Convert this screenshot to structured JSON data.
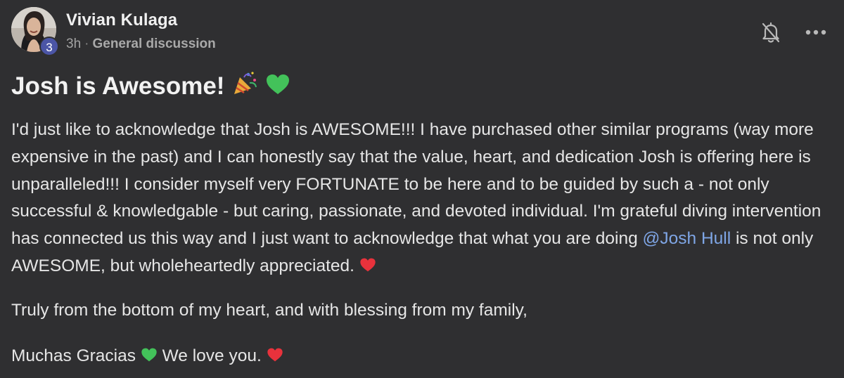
{
  "post": {
    "author": {
      "name": "Vivian Kulaga",
      "level": "3"
    },
    "time": "3h",
    "category": "General discussion",
    "title": "Josh is Awesome!",
    "body": {
      "p1_before_mention": "I'd just like to acknowledge that Josh is AWESOME!!! I have purchased other similar programs (way more expensive in the past) and I can honestly say that the value, heart, and dedication Josh is offering here is unparalleled!!! I consider myself very FORTUNATE to be here and to be guided by such a - not only successful & knowledgable - but caring, passionate, and devoted individual. I'm grateful diving intervention has connected us this way and I just want to acknowledge that what you are doing ",
      "mention": "@Josh Hull",
      "p1_after_mention": " is not only AWESOME, but wholeheartedly appreciated. ",
      "p2": "Truly from the bottom of my heart, and with blessing from my family,",
      "p3_part1": "Muchas Gracias ",
      "p3_part2": " We love you. "
    }
  },
  "icons": {
    "bell": "bell-slash-icon",
    "more": "more-horizontal-icon",
    "party": "party-popper-icon",
    "green_heart": "green-heart-icon",
    "red_heart": "red-heart-icon"
  },
  "colors": {
    "background": "#2f2f31",
    "text": "#e6e6e6",
    "muted": "#a3a3a3",
    "mention": "#7fa6e6",
    "badge": "#4b55a6",
    "green_heart": "#43c25a",
    "red_heart": "#e8323c"
  }
}
